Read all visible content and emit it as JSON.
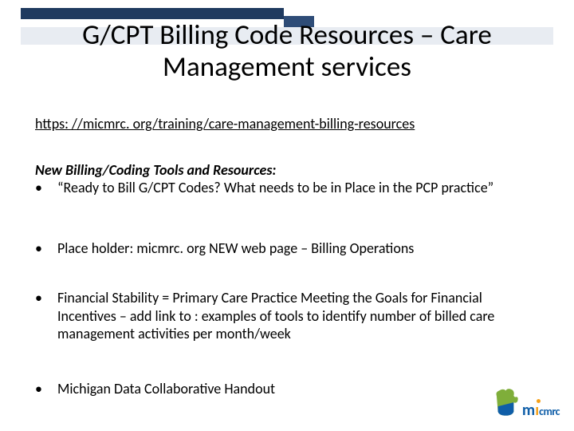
{
  "title": "G/CPT Billing Code Resources – Care Management services",
  "link_text": "https: //micmrc. org/training/care-management-billing-resources",
  "section_heading": "New Billing/Coding Tools and Resources:",
  "bullets": {
    "b1": "“Ready to Bill G/CPT Codes? What needs to be in Place in the PCP practice”",
    "b2": "Place holder:  micmrc. org NEW web page – Billing Operations",
    "b3": "Financial Stability = Primary Care Practice Meeting the Goals for Financial Incentives – add link to : examples of tools  to identify number of  billed care management activities per month/week",
    "b4": "Michigan Data Collaborative  Handout"
  },
  "logo": {
    "brand_m": "m",
    "brand_i": "ı",
    "brand_rest": "cmrc"
  }
}
